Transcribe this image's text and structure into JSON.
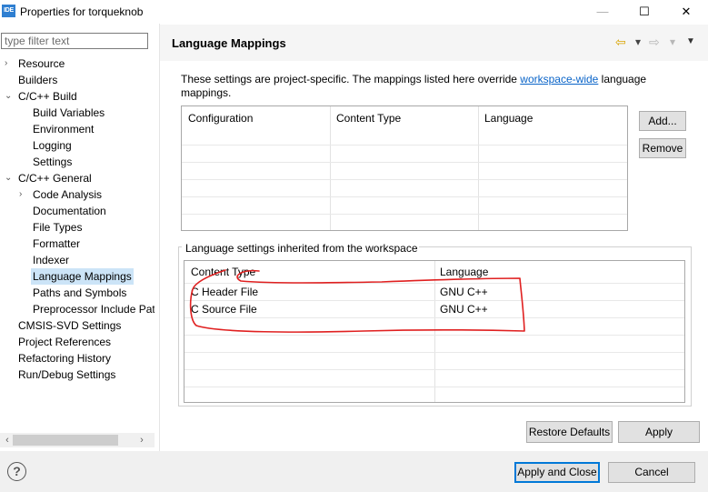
{
  "window": {
    "icon_text": "IDE",
    "title": "Properties for torqueknob",
    "minimize_glyph": "—",
    "maximize_glyph": "☐",
    "close_glyph": "✕"
  },
  "filter": {
    "placeholder": "type filter text",
    "value": ""
  },
  "tree": [
    {
      "label": "Resource",
      "arrow": "›"
    },
    {
      "label": "Builders",
      "arrow": ""
    },
    {
      "label": "C/C++ Build",
      "arrow": "⌄"
    },
    {
      "label": "Build Variables",
      "arrow": ""
    },
    {
      "label": "Environment",
      "arrow": ""
    },
    {
      "label": "Logging",
      "arrow": ""
    },
    {
      "label": "Settings",
      "arrow": ""
    },
    {
      "label": "C/C++ General",
      "arrow": "⌄"
    },
    {
      "label": "Code Analysis",
      "arrow": "›"
    },
    {
      "label": "Documentation",
      "arrow": ""
    },
    {
      "label": "File Types",
      "arrow": ""
    },
    {
      "label": "Formatter",
      "arrow": ""
    },
    {
      "label": "Indexer",
      "arrow": ""
    },
    {
      "label": "Language Mappings",
      "arrow": ""
    },
    {
      "label": "Paths and Symbols",
      "arrow": ""
    },
    {
      "label": "Preprocessor Include Paths",
      "arrow": ""
    },
    {
      "label": "CMSIS-SVD Settings",
      "arrow": ""
    },
    {
      "label": "Project References",
      "arrow": ""
    },
    {
      "label": "Refactoring History",
      "arrow": ""
    },
    {
      "label": "Run/Debug Settings",
      "arrow": ""
    }
  ],
  "scroll": {
    "left_arrow": "‹",
    "right_arrow": "›"
  },
  "page": {
    "title": "Language Mappings",
    "nav": {
      "back_glyph": "⇦",
      "forward_glyph": "⇨",
      "dropdown_glyph": "▾",
      "menu_glyph": "▼"
    },
    "description_before": "These settings are project-specific.  The mappings listed here override ",
    "description_link": "workspace-wide",
    "description_after": " language mappings."
  },
  "project_table": {
    "columns": [
      "Configuration",
      "Content Type",
      "Language"
    ],
    "rows": []
  },
  "buttons": {
    "add": "Add...",
    "remove": "Remove",
    "restore_defaults": "Restore Defaults",
    "apply": "Apply",
    "apply_and_close": "Apply and Close",
    "cancel": "Cancel"
  },
  "workspace_group": {
    "label": "Language settings inherited from the workspace",
    "columns": [
      "Content Type",
      "Language"
    ],
    "rows": [
      {
        "content_type": "C Header File",
        "language": "GNU C++"
      },
      {
        "content_type": "C Source File",
        "language": "GNU C++"
      }
    ]
  },
  "help": {
    "glyph": "?"
  },
  "colors": {
    "selection": "#cce4f7",
    "annotation": "#e02020",
    "link": "#0a64c8",
    "primary_border": "#0078d7"
  }
}
